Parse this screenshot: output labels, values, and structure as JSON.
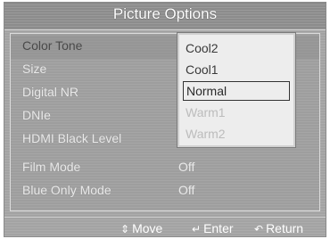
{
  "menu": {
    "title": "Picture Options",
    "items": [
      {
        "label": "Color Tone",
        "value": ""
      },
      {
        "label": "Size",
        "value": ""
      },
      {
        "label": "Digital NR",
        "value": ""
      },
      {
        "label": "DNIe",
        "value": ""
      },
      {
        "label": "HDMI Black Level",
        "value": ""
      },
      {
        "label": "Film Mode",
        "value": "Off"
      },
      {
        "label": "Blue Only Mode",
        "value": "Off"
      }
    ]
  },
  "dropdown": {
    "options": [
      "Cool2",
      "Cool1",
      "Normal",
      "Warm1",
      "Warm2"
    ],
    "selected": "Normal"
  },
  "footer": {
    "move": "Move",
    "enter": "Enter",
    "return": "Return",
    "move_icon": "updown-arrow-icon",
    "enter_icon": "enter-icon",
    "return_icon": "return-icon"
  }
}
